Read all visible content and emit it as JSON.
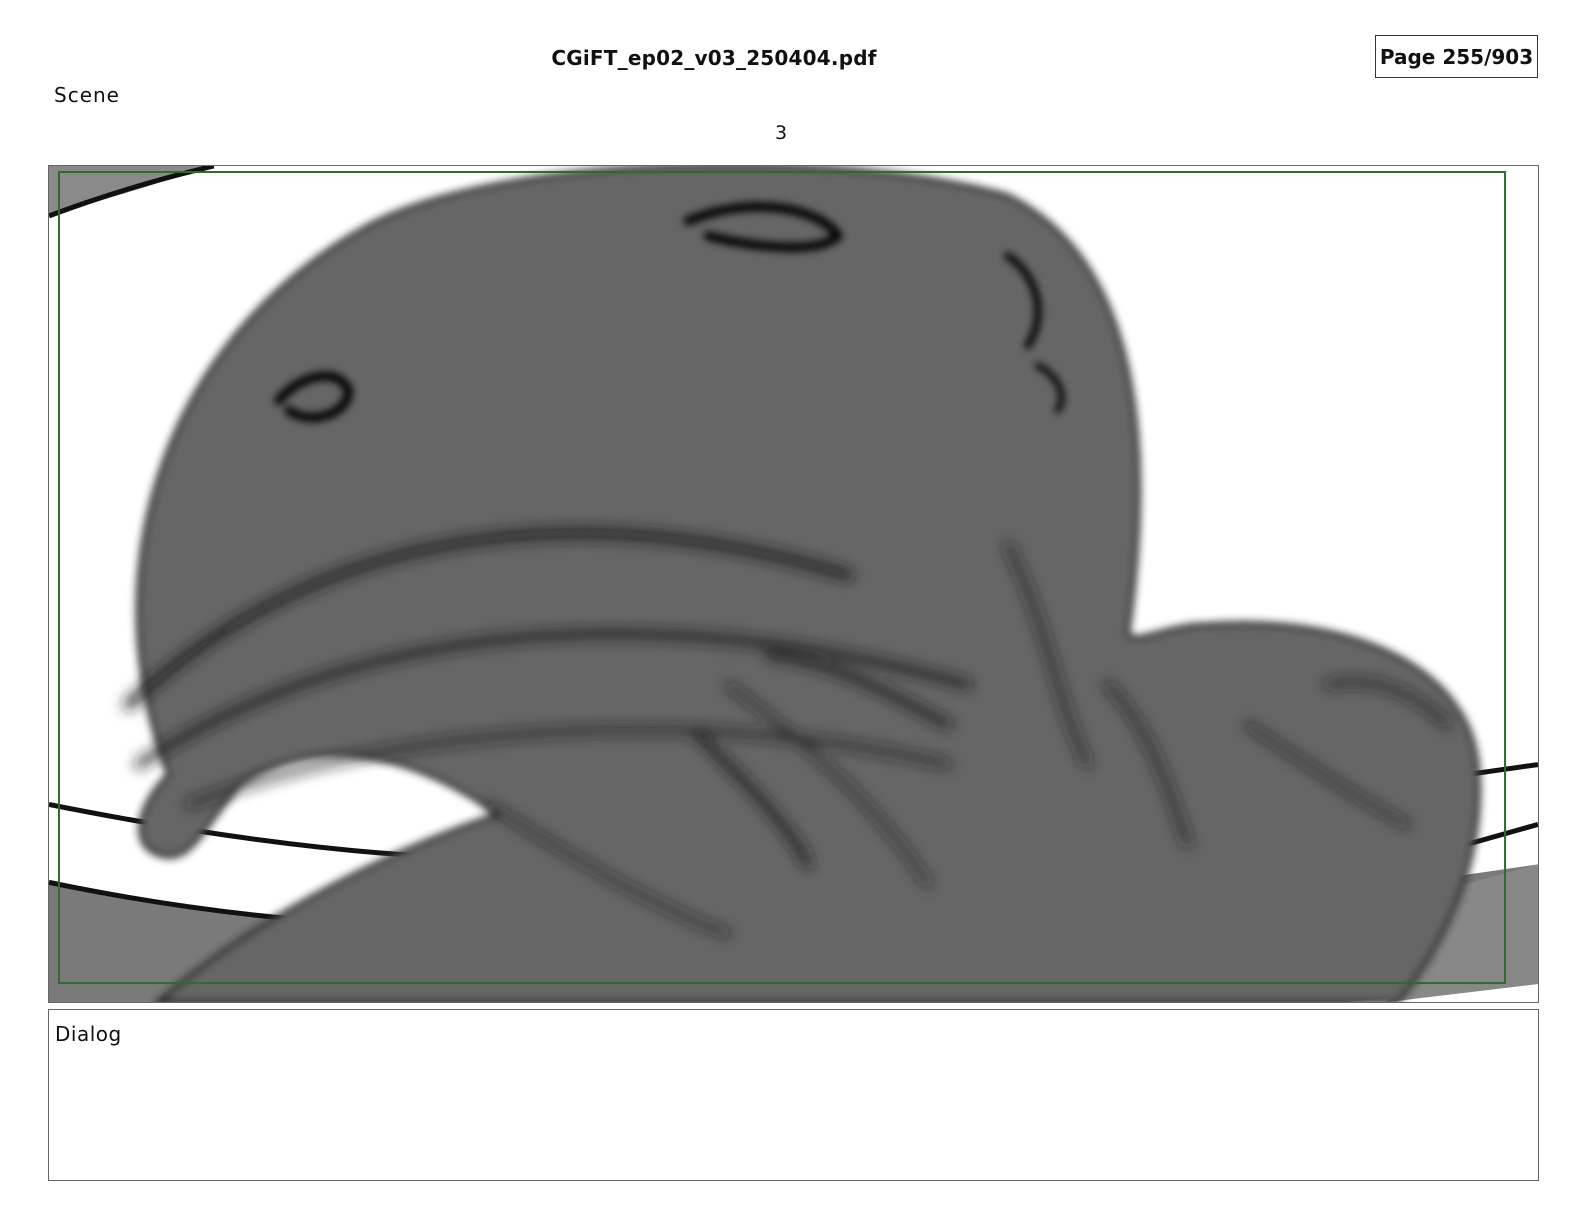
{
  "header": {
    "doc_title": "CGiFT_ep02_v03_250404.pdf",
    "page_label": "Page 255/903"
  },
  "scene": {
    "label": "Scene",
    "number": "3"
  },
  "panel": {
    "safe_frame_color": "#2e6b2e",
    "fill_color": "#666666"
  },
  "dialog": {
    "label": "Dialog",
    "text": ""
  }
}
